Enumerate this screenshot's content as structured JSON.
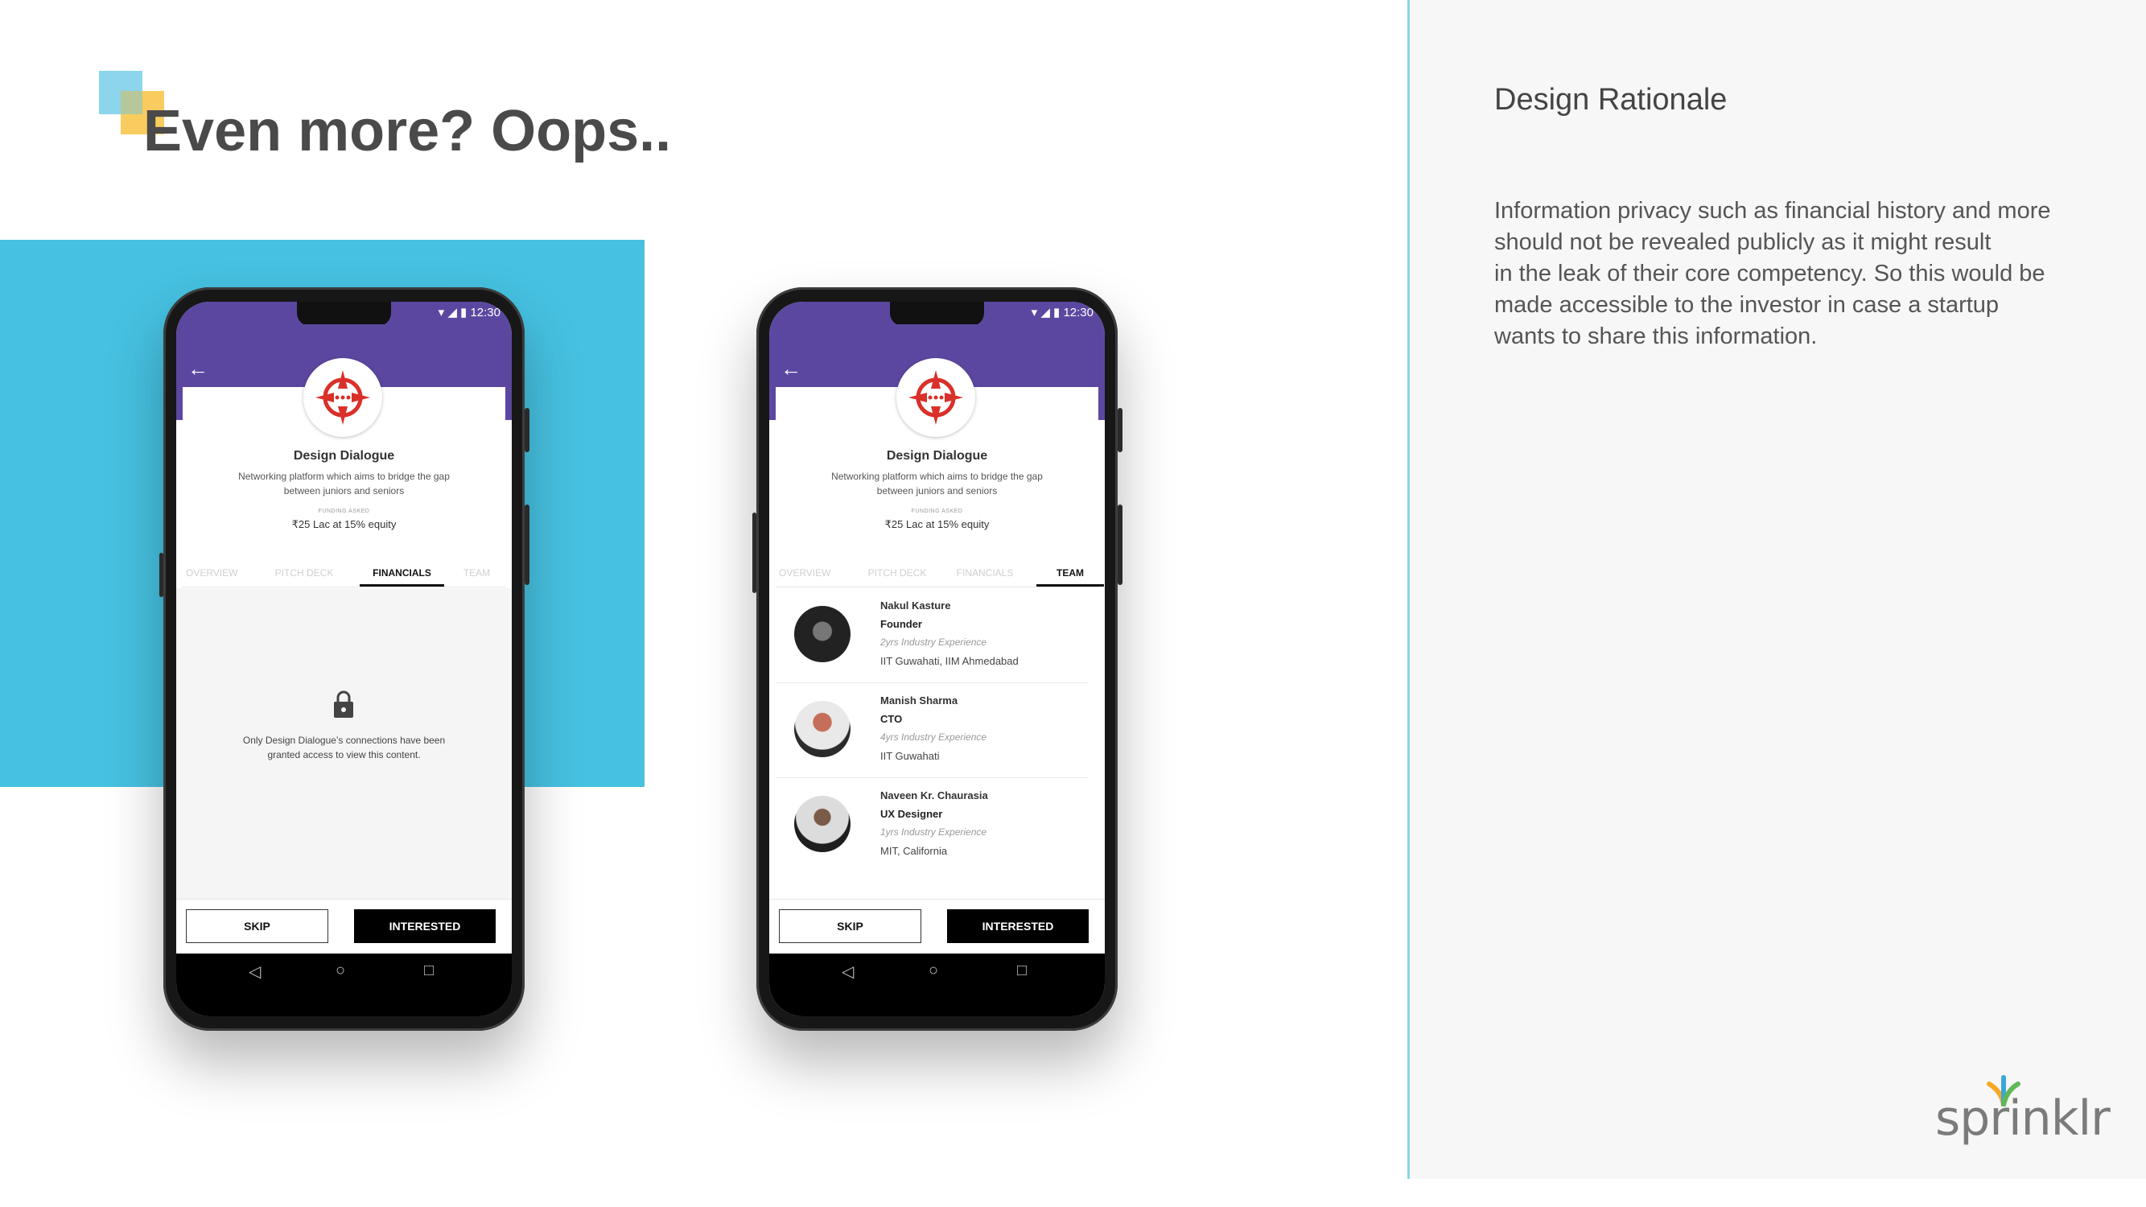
{
  "slide": {
    "title": "Even more? Oops..",
    "colors": {
      "accent_blue": "#46c1e1",
      "deco_yellow": "#f7c64d",
      "deco_light_blue": "#7fd0ea",
      "app_purple": "#5c47a0"
    }
  },
  "rationale": {
    "title": "Design Rationale",
    "body": "Information privacy such as financial history and more\nshould not be revealed publicly as it might result\nin the leak of their core competency. So this would be\nmade accessible to the investor in case a startup\nwants to share this information."
  },
  "brand": {
    "logo_text": "sprinklr"
  },
  "phone_common": {
    "status_time": "12:30",
    "back_icon": "back-arrow-icon",
    "company_name": "Design Dialogue",
    "company_description": "Networking platform which aims to bridge the gap between juniors and seniors",
    "funding_label": "FUNDING ASKED",
    "funding_value": "₹25 Lac at 15% equity",
    "tabs": [
      "OVERVIEW",
      "PITCH DECK",
      "FINANCIALS",
      "TEAM"
    ],
    "skip_label": "SKIP",
    "interested_label": "INTERESTED"
  },
  "phone_financials": {
    "active_tab": "FINANCIALS",
    "locked_message": "Only Design Dialogue’s connections have been granted access to view this content."
  },
  "phone_team": {
    "active_tab": "TEAM",
    "members": [
      {
        "name": "Nakul Kasture",
        "role": "Founder",
        "experience": "2yrs Industry Experience",
        "education": "IIT Guwahati, IIM Ahmedabad"
      },
      {
        "name": "Manish Sharma",
        "role": "CTO",
        "experience": "4yrs Industry Experience",
        "education": "IIT Guwahati"
      },
      {
        "name": "Naveen Kr. Chaurasia",
        "role": "UX Designer",
        "experience": "1yrs Industry Experience",
        "education": "MIT, California"
      }
    ]
  }
}
